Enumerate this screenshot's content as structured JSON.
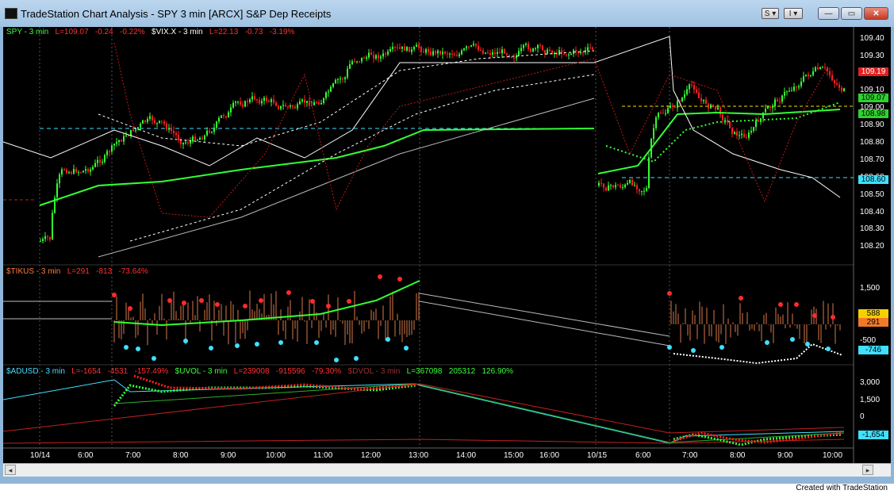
{
  "window": {
    "title": "TradeStation Chart Analysis - SPY 3 min [ARCX] S&P Dep Receipts",
    "btn_s": "S",
    "btn_i": "I",
    "minimize": "—",
    "maximize": "▭",
    "close": "✕"
  },
  "panes": {
    "price": {
      "legend": [
        {
          "text": "SPY - 3 min",
          "color": "g"
        },
        {
          "text": "L=109.07",
          "color": "r"
        },
        {
          "text": "-0.24",
          "color": "r"
        },
        {
          "text": "-0.22%",
          "color": "r"
        },
        {
          "text": "$VIX.X - 3 min",
          "color": "w"
        },
        {
          "text": "L=22.13",
          "color": "r"
        },
        {
          "text": "-0.73",
          "color": "r"
        },
        {
          "text": "-3.19%",
          "color": "r"
        }
      ],
      "axis": [
        "109.40",
        "109.30",
        "109.20",
        "109.10",
        "109.00",
        "108.90",
        "108.80",
        "108.70",
        "108.60",
        "108.50",
        "108.40",
        "108.30",
        "108.20"
      ],
      "tags": [
        {
          "text": "109.19",
          "bg": "#e02020",
          "fg": "#ffffff"
        },
        {
          "text": "109.07",
          "bg": "#2fd22f",
          "fg": "#000000"
        },
        {
          "text": "108.98",
          "bg": "#2fd22f",
          "fg": "#000000"
        },
        {
          "text": "108.60",
          "bg": "#40e0ff",
          "fg": "#000000"
        }
      ]
    },
    "tick": {
      "legend": [
        {
          "text": "$TIKUS - 3 min",
          "color": "o"
        },
        {
          "text": "L=291",
          "color": "r"
        },
        {
          "text": "-813",
          "color": "r"
        },
        {
          "text": "-73.64%",
          "color": "r"
        }
      ],
      "axis": [
        "1,500",
        "-500"
      ],
      "tags": [
        {
          "text": "588",
          "bg": "#f5d000",
          "fg": "#000000"
        },
        {
          "text": "291",
          "bg": "#f07a2a",
          "fg": "#000000"
        },
        {
          "text": "-746",
          "bg": "#40e0ff",
          "fg": "#000000"
        }
      ]
    },
    "breadth": {
      "legend": [
        {
          "text": "$ADUSD - 3 min",
          "color": "c"
        },
        {
          "text": "L=-1654",
          "color": "r"
        },
        {
          "text": "-4531",
          "color": "r"
        },
        {
          "text": "-157.49%",
          "color": "r"
        },
        {
          "text": "$UVOL - 3 min",
          "color": "g"
        },
        {
          "text": "L=239008",
          "color": "r"
        },
        {
          "text": "-915596",
          "color": "r"
        },
        {
          "text": "-79.30%",
          "color": "r"
        },
        {
          "text": "$DVOL - 3 min",
          "color": "dr"
        },
        {
          "text": "L=367098",
          "color": "g"
        },
        {
          "text": "205312",
          "color": "g"
        },
        {
          "text": "126.90%",
          "color": "g"
        }
      ],
      "axis": [
        "3,000",
        "1,500",
        "0"
      ],
      "tags": [
        {
          "text": "-1,654",
          "bg": "#40e0ff",
          "fg": "#000000"
        }
      ]
    }
  },
  "time_axis": [
    "10/14",
    "6:00",
    "7:00",
    "8:00",
    "9:00",
    "10:00",
    "11:00",
    "12:00",
    "13:00",
    "14:00",
    "15:00",
    "16:00",
    "10/15",
    "6:00",
    "7:00",
    "8:00",
    "9:00",
    "10:00"
  ],
  "footer": "Created with TradeStation",
  "colors": {
    "bull": "#33ff33",
    "bear": "#ff2020",
    "ma_fast": "#33ff33",
    "vix": "#ffffff",
    "cyan": "#40e0ff"
  }
}
